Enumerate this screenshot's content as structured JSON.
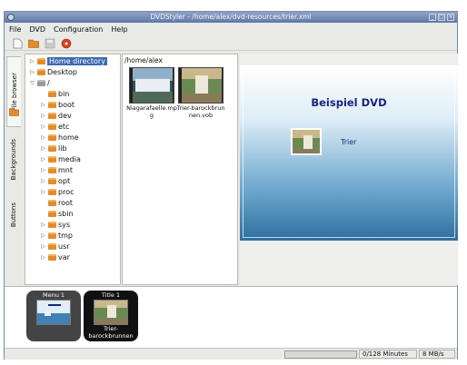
{
  "window": {
    "title": "DVDStyler - /home/alex/dvd-resources/trier.xml",
    "controls": [
      "_",
      "□",
      "×"
    ]
  },
  "menubar": {
    "items": [
      "File",
      "DVD",
      "Configuration",
      "Help"
    ]
  },
  "toolbar": {
    "buttons": [
      "new-document-icon",
      "open-folder-icon",
      "save-icon",
      "burn-disc-icon"
    ]
  },
  "side_tabs": {
    "file_browser": "File browser",
    "backgrounds": "Backgrounds",
    "buttons": "Buttons"
  },
  "tree": {
    "home": "Home directory",
    "desktop": "Desktop",
    "root": "/",
    "bin": "bin",
    "boot": "boot",
    "dev": "dev",
    "etc": "etc",
    "home_dir": "home",
    "lib": "lib",
    "media": "media",
    "mnt": "mnt",
    "opt": "opt",
    "proc": "proc",
    "root_dir": "root",
    "sbin": "sbin",
    "sys": "sys",
    "tmp": "tmp",
    "usr": "usr",
    "var": "var"
  },
  "files": {
    "path": "/home/alex",
    "file1": "Niagarafaelle.mpg",
    "file2": "Trier-barockbrunnen.vob"
  },
  "preview": {
    "menu_title": "Beispiel DVD",
    "button_label": "Trier"
  },
  "titleset": {
    "menu_label": "Menu 1",
    "title_label": "Title 1",
    "title_sub": "Trier-barockbrunnen"
  },
  "status": {
    "duration": "0/128 Minutes",
    "bitrate": "8 MB/s",
    "progress_fraction": 0
  },
  "colors": {
    "accent": "#3d6ab0",
    "menu_title": "#1a237e",
    "folder": "#e48b2a"
  }
}
